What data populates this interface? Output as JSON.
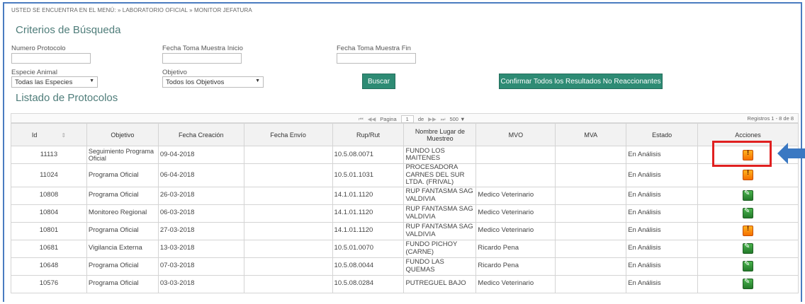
{
  "breadcrumb": "USTED SE ENCUENTRA EN EL MENÚ: » LABORATORIO OFICIAL » MONITOR JEFATURA",
  "search": {
    "title": "Criterios de Búsqueda",
    "numero_protocolo_label": "Numero Protocolo",
    "numero_protocolo_value": "",
    "fecha_inicio_label": "Fecha Toma Muestra Inicio",
    "fecha_inicio_value": "",
    "fecha_fin_label": "Fecha Toma Muestra Fin",
    "fecha_fin_value": "",
    "especie_label": "Especie Animal",
    "especie_value": "Todas las Especies",
    "objetivo_label": "Objetivo",
    "objetivo_value": "Todos los Objetivos",
    "buscar_label": "Buscar",
    "confirmar_label": "Confirmar Todos los Resultados No Reaccionantes"
  },
  "list": {
    "title": "Listado de Protocolos",
    "pager": {
      "first": "⏮",
      "prev": "◀◀",
      "pagina_label": "Pagina",
      "page": "1",
      "de_label": "de",
      "next": "▶▶",
      "last": "⏭",
      "page_size": "500 ▼",
      "registros": "Registros 1 - 8 de 8"
    },
    "columns": [
      "Id",
      "Objetivo",
      "Fecha Creación",
      "Fecha Envío",
      "Rup/Rut",
      "Nombre Lugar de Muestreo",
      "MVO",
      "MVA",
      "Estado",
      "Acciones"
    ],
    "sort_icon": "⇕",
    "rows": [
      {
        "id": "11113",
        "objetivo": "Seguimiento Programa Oficial",
        "fecha_creacion": "09-04-2018",
        "fecha_envio": "",
        "rup": "10.5.08.0071",
        "lugar": "FUNDO LOS MAITENES",
        "mvo": "",
        "mva": "",
        "estado": "En Análisis",
        "accion": "alert-icon"
      },
      {
        "id": "11024",
        "objetivo": "Programa Oficial",
        "fecha_creacion": "06-04-2018",
        "fecha_envio": "",
        "rup": "10.5.01.1031",
        "lugar": "PROCESADORA CARNES DEL SUR LTDA. (FRIVAL)",
        "mvo": "",
        "mva": "",
        "estado": "En Análisis",
        "accion": "alert-icon"
      },
      {
        "id": "10808",
        "objetivo": "Programa Oficial",
        "fecha_creacion": "26-03-2018",
        "fecha_envio": "",
        "rup": "14.1.01.1120",
        "lugar": "RUP FANTASMA SAG VALDIVIA",
        "mvo": "Medico Veterinario",
        "mva": "",
        "estado": "En Análisis",
        "accion": "edit-icon"
      },
      {
        "id": "10804",
        "objetivo": "Monitoreo Regional",
        "fecha_creacion": "06-03-2018",
        "fecha_envio": "",
        "rup": "14.1.01.1120",
        "lugar": "RUP FANTASMA SAG VALDIVIA",
        "mvo": "Medico Veterinario",
        "mva": "",
        "estado": "En Análisis",
        "accion": "edit-icon"
      },
      {
        "id": "10801",
        "objetivo": "Programa Oficial",
        "fecha_creacion": "27-03-2018",
        "fecha_envio": "",
        "rup": "14.1.01.1120",
        "lugar": "RUP FANTASMA SAG VALDIVIA",
        "mvo": "Medico Veterinario",
        "mva": "",
        "estado": "En Análisis",
        "accion": "alert-icon"
      },
      {
        "id": "10681",
        "objetivo": "Vigilancia Externa",
        "fecha_creacion": "13-03-2018",
        "fecha_envio": "",
        "rup": "10.5.01.0070",
        "lugar": "FUNDO PICHOY (CARNE)",
        "mvo": "Ricardo Pena",
        "mva": "",
        "estado": "En Análisis",
        "accion": "edit-icon"
      },
      {
        "id": "10648",
        "objetivo": "Programa Oficial",
        "fecha_creacion": "07-03-2018",
        "fecha_envio": "",
        "rup": "10.5.08.0044",
        "lugar": "FUNDO LAS QUEMAS",
        "mvo": "Ricardo Pena",
        "mva": "",
        "estado": "En Análisis",
        "accion": "edit-icon"
      },
      {
        "id": "10576",
        "objetivo": "Programa Oficial",
        "fecha_creacion": "03-03-2018",
        "fecha_envio": "",
        "rup": "10.5.08.0284",
        "lugar": "PUTREGUEL BAJO",
        "mvo": "Medico Veterinario",
        "mva": "",
        "estado": "En Análisis",
        "accion": "edit-icon"
      }
    ]
  },
  "colors": {
    "accent": "#2e8b74",
    "title": "#4f7d7a",
    "highlight": "#e02020",
    "pointer": "#3a78c2",
    "frame": "#4a7cc0"
  }
}
